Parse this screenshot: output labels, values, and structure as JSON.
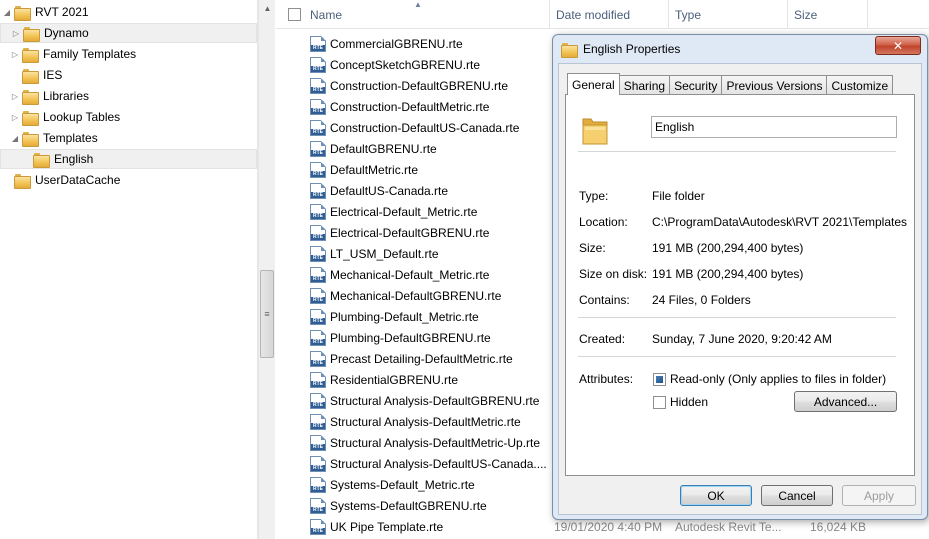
{
  "nav": {
    "items": [
      {
        "label": "RVT 2021",
        "arrow": "expanded"
      },
      {
        "label": "Dynamo",
        "arrow": "collapsed"
      },
      {
        "label": "Family Templates",
        "arrow": "collapsed"
      },
      {
        "label": "IES",
        "arrow": ""
      },
      {
        "label": "Libraries",
        "arrow": "collapsed"
      },
      {
        "label": "Lookup Tables",
        "arrow": "collapsed"
      },
      {
        "label": "Templates",
        "arrow": "expanded"
      },
      {
        "label": "English",
        "arrow": ""
      },
      {
        "label": "UserDataCache",
        "arrow": ""
      }
    ]
  },
  "columns": {
    "name": "Name",
    "date_modified": "Date modified",
    "type": "Type",
    "size": "Size"
  },
  "files": [
    "CommercialGBRENU.rte",
    "ConceptSketchGBRENU.rte",
    "Construction-DefaultGBRENU.rte",
    "Construction-DefaultMetric.rte",
    "Construction-DefaultUS-Canada.rte",
    "DefaultGBRENU.rte",
    "DefaultMetric.rte",
    "DefaultUS-Canada.rte",
    "Electrical-Default_Metric.rte",
    "Electrical-DefaultGBRENU.rte",
    "LT_USM_Default.rte",
    "Mechanical-Default_Metric.rte",
    "Mechanical-DefaultGBRENU.rte",
    "Plumbing-Default_Metric.rte",
    "Plumbing-DefaultGBRENU.rte",
    "Precast Detailing-DefaultMetric.rte",
    "ResidentialGBRENU.rte",
    "Structural Analysis-DefaultGBRENU.rte",
    "Structural Analysis-DefaultMetric.rte",
    "Structural Analysis-DefaultMetric-Up.rte",
    "Structural Analysis-DefaultUS-Canada....",
    "Systems-Default_Metric.rte",
    "Systems-DefaultGBRENU.rte",
    "UK Pipe Template.rte"
  ],
  "last_row_details": {
    "date_modified": "19/01/2020 4:40 PM",
    "type": "Autodesk Revit Te...",
    "size": "16,024 KB"
  },
  "dialog": {
    "title": "English Properties",
    "close_label": "✕",
    "tabs": [
      "General",
      "Sharing",
      "Security",
      "Previous Versions",
      "Customize"
    ],
    "folder_name": "English",
    "properties": {
      "type_label": "Type:",
      "type_value": "File folder",
      "location_label": "Location:",
      "location_value": "C:\\ProgramData\\Autodesk\\RVT 2021\\Templates",
      "size_label": "Size:",
      "size_value": "191 MB (200,294,400 bytes)",
      "size_on_disk_label": "Size on disk:",
      "size_on_disk_value": "191 MB (200,294,400 bytes)",
      "contains_label": "Contains:",
      "contains_value": "24 Files, 0 Folders",
      "created_label": "Created:",
      "created_value": "Sunday, 7 June 2020, 9:20:42 AM",
      "attributes_label": "Attributes:",
      "readonly_label": "Read-only (Only applies to files in folder)",
      "hidden_label": "Hidden",
      "advanced_label": "Advanced..."
    },
    "buttons": {
      "ok": "OK",
      "cancel": "Cancel",
      "apply": "Apply"
    }
  }
}
